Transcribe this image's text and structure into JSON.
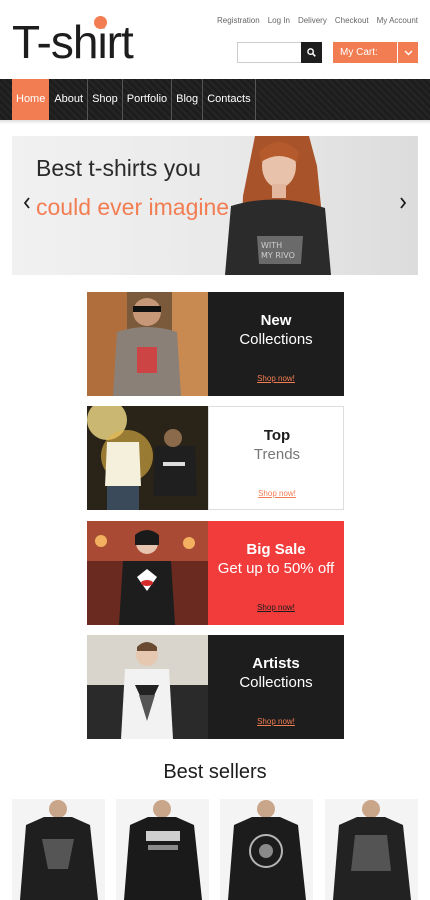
{
  "header": {
    "logo": "T-shirt",
    "top_links": [
      "Registration",
      "Log In",
      "Delivery",
      "Checkout",
      "My Account"
    ],
    "search": {
      "placeholder": "",
      "value": "",
      "button_icon": "search-icon"
    },
    "cart": {
      "label": "My Cart:",
      "arrow_icon": "chevron-down-icon"
    }
  },
  "nav": {
    "items": [
      {
        "label": "Home",
        "active": true
      },
      {
        "label": "About",
        "active": false
      },
      {
        "label": "Shop",
        "active": false
      },
      {
        "label": "Portfolio",
        "active": false
      },
      {
        "label": "Blog",
        "active": false
      },
      {
        "label": "Contacts",
        "active": false
      }
    ]
  },
  "slider": {
    "line1": "Best t-shirts you",
    "line2": "could ever imagine",
    "prev_icon": "chevron-left-icon",
    "next_icon": "chevron-right-icon"
  },
  "promos": [
    {
      "title": "New",
      "subtitle": "Collections",
      "link": "Shop now!"
    },
    {
      "title": "Top",
      "subtitle": "Trends",
      "link": "Shop now!"
    },
    {
      "title": "Big Sale",
      "subtitle": "Get up to 50% off",
      "link": "Shop now!"
    },
    {
      "title": "Artists",
      "subtitle": "Collections",
      "link": "Shop now!"
    }
  ],
  "best_sellers": {
    "title": "Best sellers"
  },
  "colors": {
    "accent": "#f27d52",
    "dark": "#1d1d1d",
    "sale_red": "#f23c3c"
  }
}
